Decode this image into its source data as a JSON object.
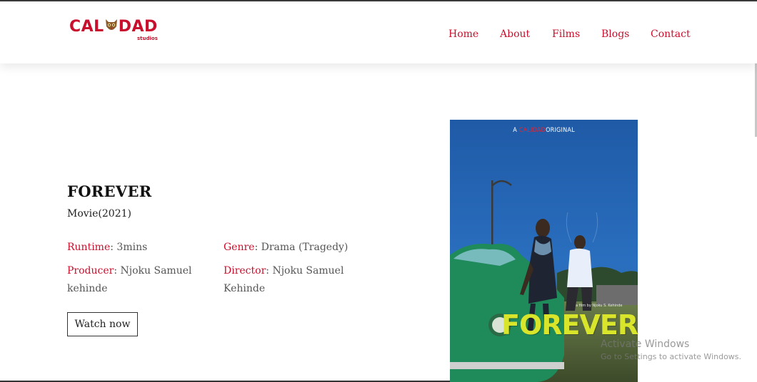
{
  "brand": {
    "logo_text_left": "CAL",
    "logo_text_right": "DAD",
    "logo_sub": "studios",
    "color": "#c8102e"
  },
  "nav": [
    {
      "label": "Home"
    },
    {
      "label": "About"
    },
    {
      "label": "Films"
    },
    {
      "label": "Blogs"
    },
    {
      "label": "Contact"
    }
  ],
  "film": {
    "title": "FOREVER",
    "subtitle": "Movie(2021)",
    "runtime_label": "Runtime",
    "runtime_value": "3mins",
    "genre_label": "Genre",
    "genre_value": "Drama (Tragedy)",
    "producer_label": "Producer",
    "producer_value_line1": "Njoku Samuel",
    "producer_value_line2": "kehinde",
    "director_label": "Director",
    "director_value_line1": "Njoku Samuel",
    "director_value_line2": "Kehinde",
    "watch_label": "Watch now"
  },
  "poster": {
    "top_prefix": "A",
    "top_brand": "CALIDAD",
    "top_suffix": "ORIGINAL",
    "credit": "a film by Njoku S. Kehinde",
    "title": "FOREVER"
  },
  "watermark": {
    "line1": "Activate Windows",
    "line2": "Go to Settings to activate Windows."
  },
  "colors": {
    "accent": "#c8102e",
    "poster_title": "#d8e52a",
    "sky": "#1f5aa6"
  }
}
